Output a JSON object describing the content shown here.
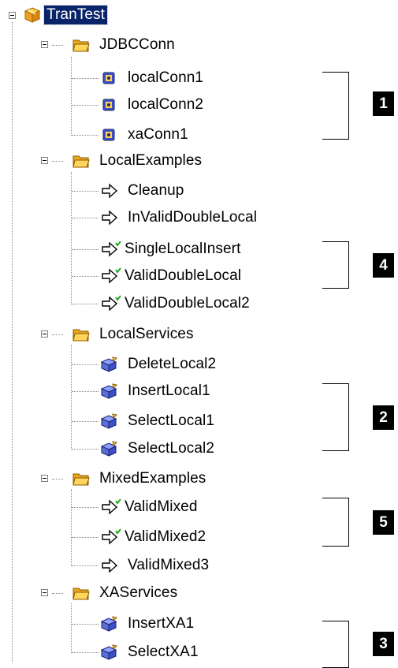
{
  "tree": {
    "root": {
      "label": "TranTest",
      "icon": "package-icon"
    },
    "folders": [
      {
        "label": "JDBCConn",
        "icon": "folder-open-icon",
        "children": [
          {
            "label": "localConn1",
            "icon": "connection-icon"
          },
          {
            "label": "localConn2",
            "icon": "connection-icon"
          },
          {
            "label": "xaConn1",
            "icon": "connection-icon"
          }
        ]
      },
      {
        "label": "LocalExamples",
        "icon": "folder-open-icon",
        "children": [
          {
            "label": "Cleanup",
            "icon": "flow-arrow-icon",
            "checked": false
          },
          {
            "label": "InValidDoubleLocal",
            "icon": "flow-arrow-icon",
            "checked": false
          },
          {
            "label": "SingleLocalInsert",
            "icon": "flow-arrow-checked-icon",
            "checked": true
          },
          {
            "label": "ValidDoubleLocal",
            "icon": "flow-arrow-checked-icon",
            "checked": true
          },
          {
            "label": "ValidDoubleLocal2",
            "icon": "flow-arrow-checked-icon",
            "checked": true
          }
        ]
      },
      {
        "label": "LocalServices",
        "icon": "folder-open-icon",
        "children": [
          {
            "label": "DeleteLocal2",
            "icon": "service-icon"
          },
          {
            "label": "InsertLocal1",
            "icon": "service-icon"
          },
          {
            "label": "SelectLocal1",
            "icon": "service-icon"
          },
          {
            "label": "SelectLocal2",
            "icon": "service-icon"
          }
        ]
      },
      {
        "label": "MixedExamples",
        "icon": "folder-open-icon",
        "children": [
          {
            "label": "ValidMixed",
            "icon": "flow-arrow-checked-icon",
            "checked": true
          },
          {
            "label": "ValidMixed2",
            "icon": "flow-arrow-checked-icon",
            "checked": true
          },
          {
            "label": "ValidMixed3",
            "icon": "flow-arrow-icon",
            "checked": false
          }
        ]
      },
      {
        "label": "XAServices",
        "icon": "folder-open-icon",
        "children": [
          {
            "label": "InsertXA1",
            "icon": "service-icon"
          },
          {
            "label": "SelectXA1",
            "icon": "service-icon"
          }
        ]
      }
    ]
  },
  "callouts": [
    {
      "number": "1"
    },
    {
      "number": "4"
    },
    {
      "number": "2"
    },
    {
      "number": "5"
    },
    {
      "number": "3"
    }
  ],
  "colors": {
    "selection": "#0a246a",
    "folder": "#f5c542",
    "checkmark": "#22aa22",
    "service": "#5a6fd6"
  }
}
